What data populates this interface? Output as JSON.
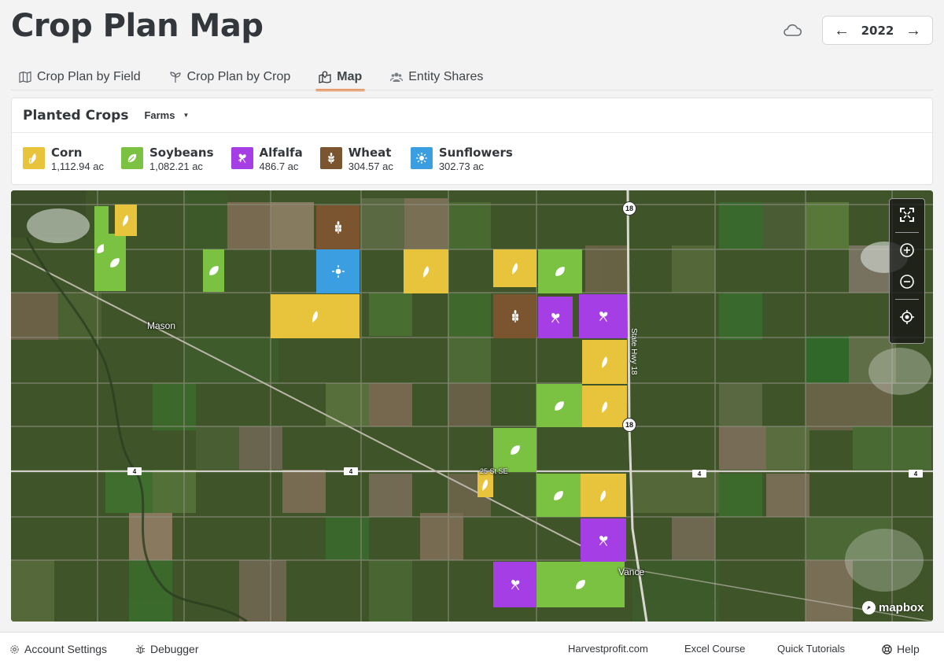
{
  "header": {
    "title": "Crop Plan Map",
    "year": "2022",
    "prev_arrow": "←",
    "next_arrow": "→"
  },
  "tabs": [
    {
      "label": "Crop Plan by Field",
      "icon": "map-icon",
      "active": false
    },
    {
      "label": "Crop Plan by Crop",
      "icon": "sprout-icon",
      "active": false
    },
    {
      "label": "Map",
      "icon": "map-marker-icon",
      "active": true
    },
    {
      "label": "Entity Shares",
      "icon": "users-icon",
      "active": false
    }
  ],
  "panel": {
    "title": "Planted Crops",
    "filter_label": "Farms",
    "crops": [
      {
        "name": "Corn",
        "area": "1,112.94 ac",
        "color": "#e8c43c",
        "icon": "corn-icon"
      },
      {
        "name": "Soybeans",
        "area": "1,082.21 ac",
        "color": "#7cc242",
        "icon": "soybean-icon"
      },
      {
        "name": "Alfalfa",
        "area": "486.7 ac",
        "color": "#a63ee6",
        "icon": "alfalfa-icon"
      },
      {
        "name": "Wheat",
        "area": "304.57 ac",
        "color": "#7a5530",
        "icon": "wheat-icon"
      },
      {
        "name": "Sunflowers",
        "area": "302.73 ac",
        "color": "#3a9ee0",
        "icon": "sunflower-icon"
      }
    ]
  },
  "map": {
    "places": [
      "Mason",
      "Vance"
    ],
    "road_labels": [
      "State Hwy 18",
      "25 St SE"
    ],
    "shields": [
      "18",
      "18",
      "4",
      "4",
      "4",
      "4"
    ],
    "attribution": "mapbox"
  },
  "footer": {
    "account_settings": "Account Settings",
    "debugger": "Debugger",
    "links": [
      "Harvestprofit.com",
      "Excel Course",
      "Quick Tutorials"
    ],
    "help": "Help"
  }
}
